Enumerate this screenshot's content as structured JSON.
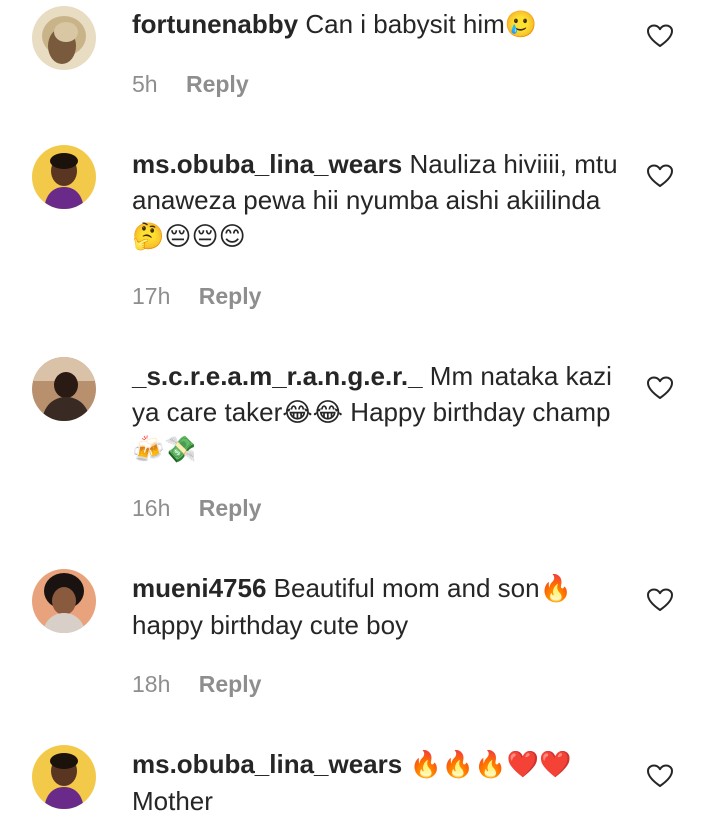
{
  "comments": [
    {
      "username": "fortunenabby",
      "text": "Can i babysit him",
      "emojis": "🥲",
      "time": "5h",
      "reply": "Reply",
      "avatar_icon": "profile-photo"
    },
    {
      "username": "ms.obuba_lina_wears",
      "text": "Nauliza hiviiii, mtu anaweza pewa hii nyumba aishi akiilinda",
      "emojis": "🤔😔😔😊",
      "time": "17h",
      "reply": "Reply",
      "avatar_icon": "profile-photo"
    },
    {
      "username": "_s.c.r.e.a.m_r.a.n.g.e.r._",
      "text": "Mm nataka kazi ya care taker",
      "emojis": "😂😂",
      "text2": "Happy birthday champ",
      "emojis2": "🍻💸",
      "time": "16h",
      "reply": "Reply",
      "avatar_icon": "profile-photo"
    },
    {
      "username": "mueni4756",
      "text": "Beautiful mom and son",
      "emojis": "🔥",
      "text2": "happy birthday cute boy",
      "time": "18h",
      "reply": "Reply",
      "avatar_icon": "profile-photo"
    },
    {
      "username": "ms.obuba_lina_wears",
      "text": "",
      "emojis": "🔥🔥🔥❤️❤️",
      "text2": "Mother",
      "avatar_icon": "profile-photo"
    }
  ],
  "colors": {
    "text": "#262626",
    "secondary": "#8e8e8e",
    "background": "#ffffff"
  },
  "icons": {
    "like": "heart-outline-icon"
  }
}
